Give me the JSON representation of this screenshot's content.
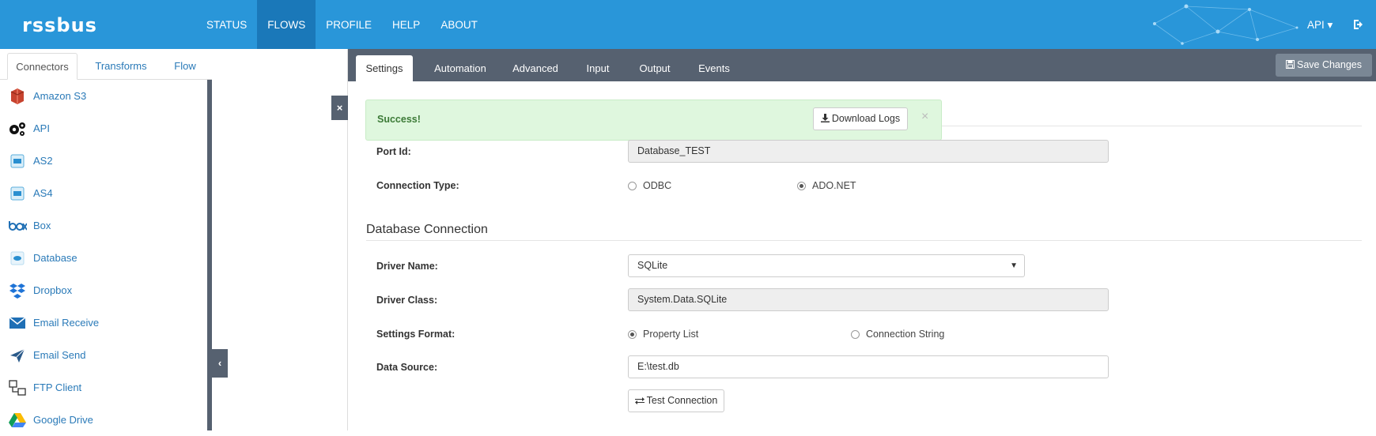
{
  "app": {
    "logo": "rssbus"
  },
  "nav": [
    "STATUS",
    "FLOWS",
    "PROFILE",
    "HELP",
    "ABOUT"
  ],
  "nav_active": "FLOWS",
  "user_menu": "API ▾",
  "left_panel": {
    "tabs": [
      "Connectors",
      "Transforms",
      "Flow"
    ],
    "active_tab": "Connectors",
    "connectors": [
      "Amazon S3",
      "API",
      "AS2",
      "AS4",
      "Box",
      "Database",
      "Dropbox",
      "Email Receive",
      "Email Send",
      "FTP Client",
      "Google Drive"
    ]
  },
  "gutter": {
    "close": "×",
    "expand": "‹"
  },
  "main_tabs": [
    "Settings",
    "Automation",
    "Advanced",
    "Input",
    "Output",
    "Events"
  ],
  "main_tab_active": "Settings",
  "toolbar": {
    "save_label": "Save Changes"
  },
  "alert": {
    "text": "Success!",
    "download_label": "Download Logs",
    "close": "×"
  },
  "form": {
    "port_id_label": "Port Id:",
    "port_id_value": "Database_TEST",
    "connection_type_label": "Connection Type:",
    "connection_options": [
      "ODBC",
      "ADO.NET"
    ],
    "connection_selected": "ADO.NET",
    "section_title": "Database Connection",
    "driver_name_label": "Driver Name:",
    "driver_name_value": "SQLite",
    "driver_class_label": "Driver Class:",
    "driver_class_value": "System.Data.SQLite",
    "settings_format_label": "Settings Format:",
    "settings_format_options": [
      "Property List",
      "Connection String"
    ],
    "settings_format_selected": "Property List",
    "data_source_label": "Data Source:",
    "data_source_value": "E:\\test.db",
    "test_connection_label": "Test Connection"
  },
  "colors": {
    "topbar": "#2996d9",
    "nav_active": "#1a78b9",
    "tabbar": "#566170",
    "link": "#2a7ab8",
    "success_bg": "#dff7de"
  }
}
